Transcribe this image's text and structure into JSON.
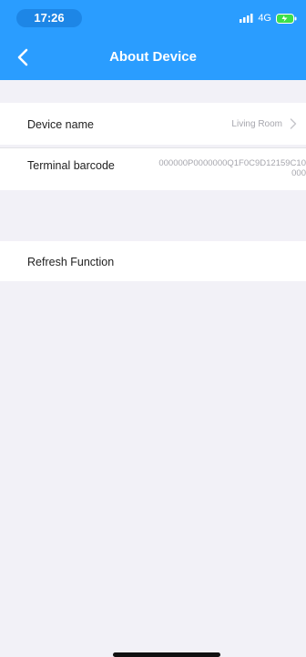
{
  "status_bar": {
    "time": "17:26",
    "network": "4G"
  },
  "nav": {
    "title": "About Device"
  },
  "rows": {
    "device_name": {
      "label": "Device name",
      "value": "Living Room"
    },
    "terminal_barcode": {
      "label": "Terminal barcode",
      "value_line1": "000000P0000000Q1F0C9D12159C10",
      "value_line2": "000"
    },
    "refresh": {
      "label": "Refresh Function"
    }
  },
  "colors": {
    "accent": "#2a9dff",
    "background": "#f2f1f7",
    "battery": "#3ce04b"
  },
  "icons": {
    "back": "chevron-left-icon",
    "device_name_disclosure": "chevron-right-icon",
    "signal": "signal-icon",
    "battery": "battery-icon"
  }
}
